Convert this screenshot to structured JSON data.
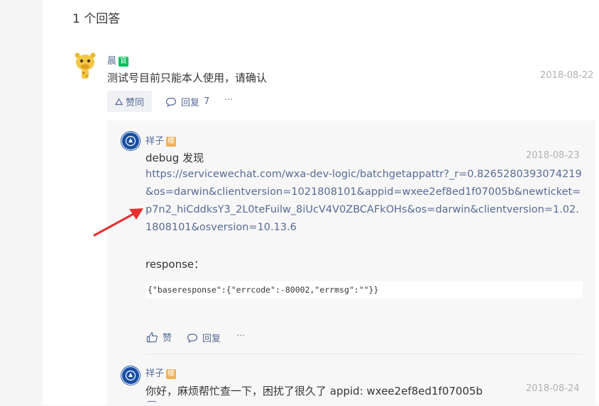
{
  "header": {
    "answer_count": "1 个回答"
  },
  "answer": {
    "author": "晨",
    "author_badge": "官",
    "content": "测试号目前只能本人使用，请确认",
    "date": "2018-08-22",
    "actions": {
      "like": "赞同",
      "reply": "回复",
      "reply_count": "7",
      "more": "···"
    }
  },
  "replies": [
    {
      "author": "祥子",
      "author_badge": "楼",
      "date": "2018-08-23",
      "line1": "debug  发现",
      "link": "https://servicewechat.com/wxa-dev-logic/batchgetappattr?_r=0.8265280393074219&os=darwin&clientversion=1021808101&appid=wxee2ef8ed1f07005b&newticket=p7n2_hiCddksY3_2L0teFuilw_8iUcV4V0ZBCAFkOHs&os=darwin&clientversion=1.02.1808101&osversion=10.13.6",
      "response_label": "response：",
      "code": "{\"baseresponse\":{\"errcode\":-80002,\"errmsg\":\"\"}}",
      "actions": {
        "like": "赞",
        "reply": "回复",
        "more": "···"
      }
    },
    {
      "author": "祥子",
      "author_badge": "楼",
      "date": "2018-08-24",
      "content": "你好，麻烦帮忙查一下，困扰了很久了 appid: wxee2ef8ed1f07005b"
    }
  ],
  "colors": {
    "link": "#576b95",
    "annotation_arrow": "#e53030",
    "badge_green": "#07c160",
    "badge_orange": "#f0b25a"
  }
}
